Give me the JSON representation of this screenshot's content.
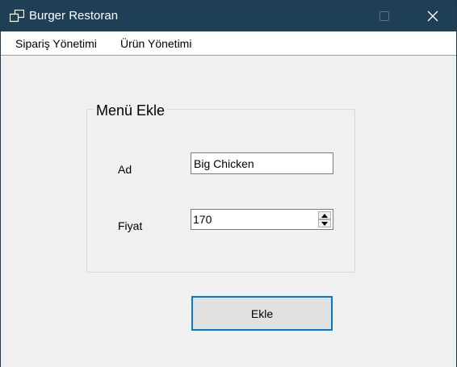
{
  "window": {
    "title": "Burger Restoran",
    "icon": "app-window-icon",
    "controls": [
      "minimize-icon",
      "maximize-icon",
      "close-icon"
    ]
  },
  "menu": {
    "items": [
      {
        "label": "Sipariş Yönetimi"
      },
      {
        "label": "Ürün Yönetimi"
      }
    ]
  },
  "form": {
    "group_title": "Menü Ekle",
    "name_label": "Ad",
    "name_value": "Big Chicken",
    "price_label": "Fiyat",
    "price_value": "170",
    "submit_label": "Ekle"
  },
  "colors": {
    "titlebar": "#1f3f57",
    "accent": "#0078d7",
    "background": "#f0f0f0"
  }
}
